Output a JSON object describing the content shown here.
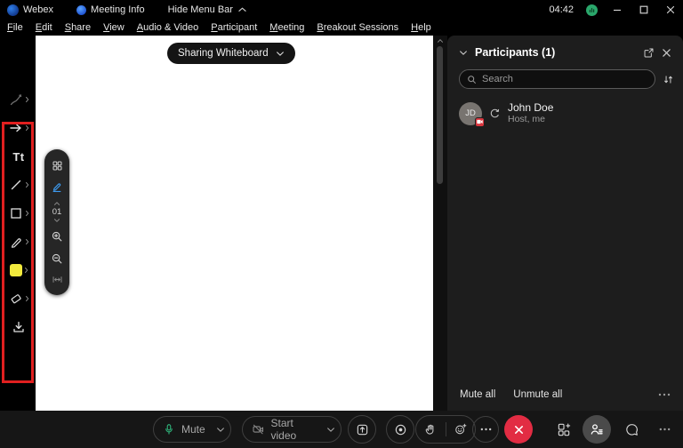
{
  "titlebar": {
    "app_name": "Webex",
    "meeting_info_label": "Meeting Info",
    "hide_menu_label": "Hide Menu Bar",
    "time": "04:42"
  },
  "menubar": {
    "items": [
      {
        "label": "File"
      },
      {
        "label": "Edit"
      },
      {
        "label": "Share"
      },
      {
        "label": "View"
      },
      {
        "label": "Audio & Video"
      },
      {
        "label": "Participant"
      },
      {
        "label": "Meeting"
      },
      {
        "label": "Breakout Sessions"
      },
      {
        "label": "Help"
      }
    ]
  },
  "whiteboard": {
    "sharing_label": "Sharing Whiteboard",
    "page_number": "01",
    "text_tool_label": "Tt",
    "annotation_tools": [
      "laser-pointer",
      "arrow",
      "text",
      "line",
      "shape",
      "pen",
      "color-yellow",
      "eraser",
      "save"
    ]
  },
  "participants_panel": {
    "title": "Participants (1)",
    "search_placeholder": "Search",
    "participants": [
      {
        "initials": "JD",
        "name": "John Doe",
        "role": "Host, me"
      }
    ],
    "mute_all_label": "Mute all",
    "unmute_all_label": "Unmute all"
  },
  "control_bar": {
    "mute_label": "Mute",
    "start_video_label": "Start video"
  },
  "colors": {
    "accent_blue": "#3d9bf0",
    "leave_red": "#e22c43",
    "mic_green": "#2eae77",
    "annotation_highlight_red": "#e11f1f",
    "yellow_swatch": "#f2ea3d",
    "participants_active_bg": "#4a4a4a"
  }
}
